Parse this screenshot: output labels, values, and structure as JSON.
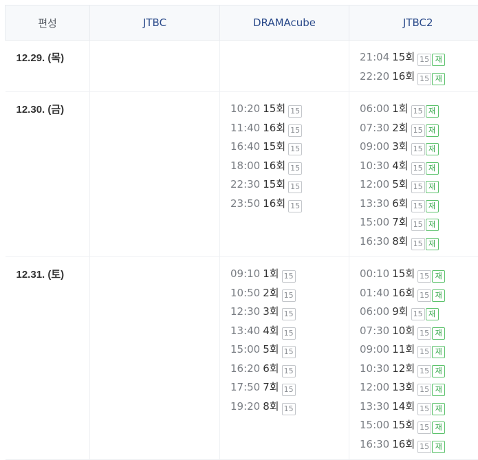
{
  "header": {
    "label": "편성",
    "channels": [
      "JTBC",
      "DRAMAcube",
      "JTBC2"
    ]
  },
  "badges": {
    "age": "15",
    "rerun": "재"
  },
  "rows": [
    {
      "date": "12.29. (목)",
      "slots": [
        [],
        [],
        [
          {
            "time": "21:04",
            "ep": "15회",
            "rerun": true
          },
          {
            "time": "22:20",
            "ep": "16회",
            "rerun": true
          }
        ]
      ]
    },
    {
      "date": "12.30. (금)",
      "slots": [
        [],
        [
          {
            "time": "10:20",
            "ep": "15회",
            "rerun": false
          },
          {
            "time": "11:40",
            "ep": "16회",
            "rerun": false
          },
          {
            "time": "16:40",
            "ep": "15회",
            "rerun": false
          },
          {
            "time": "18:00",
            "ep": "16회",
            "rerun": false
          },
          {
            "time": "22:30",
            "ep": "15회",
            "rerun": false
          },
          {
            "time": "23:50",
            "ep": "16회",
            "rerun": false
          }
        ],
        [
          {
            "time": "06:00",
            "ep": "1회",
            "rerun": true
          },
          {
            "time": "07:30",
            "ep": "2회",
            "rerun": true
          },
          {
            "time": "09:00",
            "ep": "3회",
            "rerun": true
          },
          {
            "time": "10:30",
            "ep": "4회",
            "rerun": true
          },
          {
            "time": "12:00",
            "ep": "5회",
            "rerun": true
          },
          {
            "time": "13:30",
            "ep": "6회",
            "rerun": true
          },
          {
            "time": "15:00",
            "ep": "7회",
            "rerun": true
          },
          {
            "time": "16:30",
            "ep": "8회",
            "rerun": true
          }
        ]
      ]
    },
    {
      "date": "12.31. (토)",
      "slots": [
        [],
        [
          {
            "time": "09:10",
            "ep": "1회",
            "rerun": false
          },
          {
            "time": "10:50",
            "ep": "2회",
            "rerun": false
          },
          {
            "time": "12:30",
            "ep": "3회",
            "rerun": false
          },
          {
            "time": "13:40",
            "ep": "4회",
            "rerun": false
          },
          {
            "time": "15:00",
            "ep": "5회",
            "rerun": false
          },
          {
            "time": "16:20",
            "ep": "6회",
            "rerun": false
          },
          {
            "time": "17:50",
            "ep": "7회",
            "rerun": false
          },
          {
            "time": "19:20",
            "ep": "8회",
            "rerun": false
          }
        ],
        [
          {
            "time": "00:10",
            "ep": "15회",
            "rerun": true
          },
          {
            "time": "01:40",
            "ep": "16회",
            "rerun": true
          },
          {
            "time": "06:00",
            "ep": "9회",
            "rerun": true
          },
          {
            "time": "07:30",
            "ep": "10회",
            "rerun": true
          },
          {
            "time": "09:00",
            "ep": "11회",
            "rerun": true
          },
          {
            "time": "10:30",
            "ep": "12회",
            "rerun": true
          },
          {
            "time": "12:00",
            "ep": "13회",
            "rerun": true
          },
          {
            "time": "13:30",
            "ep": "14회",
            "rerun": true
          },
          {
            "time": "15:00",
            "ep": "15회",
            "rerun": true
          },
          {
            "time": "16:30",
            "ep": "16회",
            "rerun": true
          }
        ]
      ]
    }
  ]
}
